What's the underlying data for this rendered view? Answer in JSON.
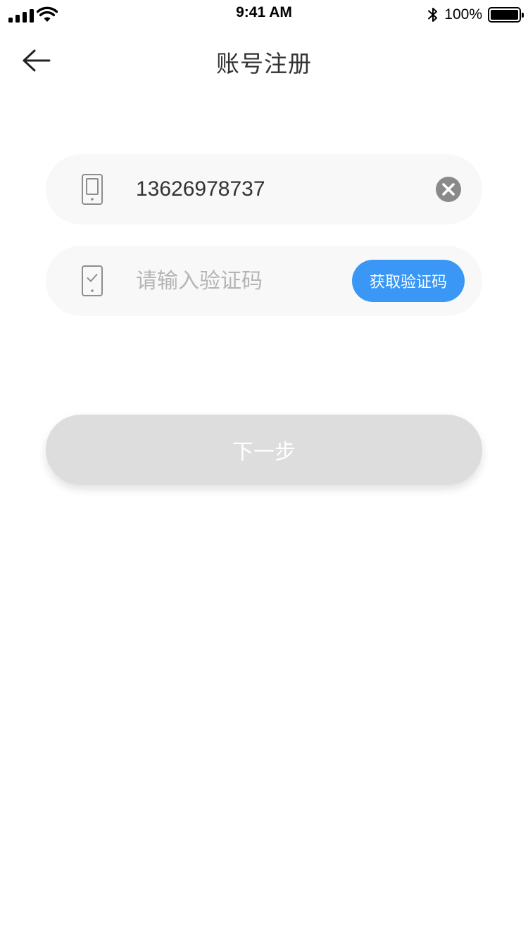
{
  "status_bar": {
    "time": "9:41 AM",
    "battery_percent": "100%",
    "battery_level": 1.0,
    "icons": [
      "signal-icon",
      "wifi-icon",
      "bluetooth-icon",
      "battery-icon"
    ]
  },
  "nav": {
    "title": "账号注册",
    "back_icon": "arrow-left-icon"
  },
  "form": {
    "phone": {
      "value": "13626978737",
      "icon": "phone-icon",
      "clear_icon": "clear-icon"
    },
    "code": {
      "value": "",
      "placeholder": "请输入验证码",
      "icon": "phone-check-icon",
      "get_code_label": "获取验证码"
    },
    "next_label": "下一步"
  },
  "colors": {
    "primary": "#3a97f5",
    "field_bg": "#f8f8f8",
    "disabled_button": "#dddddd",
    "placeholder": "#b5b5b5",
    "text": "#333333"
  }
}
